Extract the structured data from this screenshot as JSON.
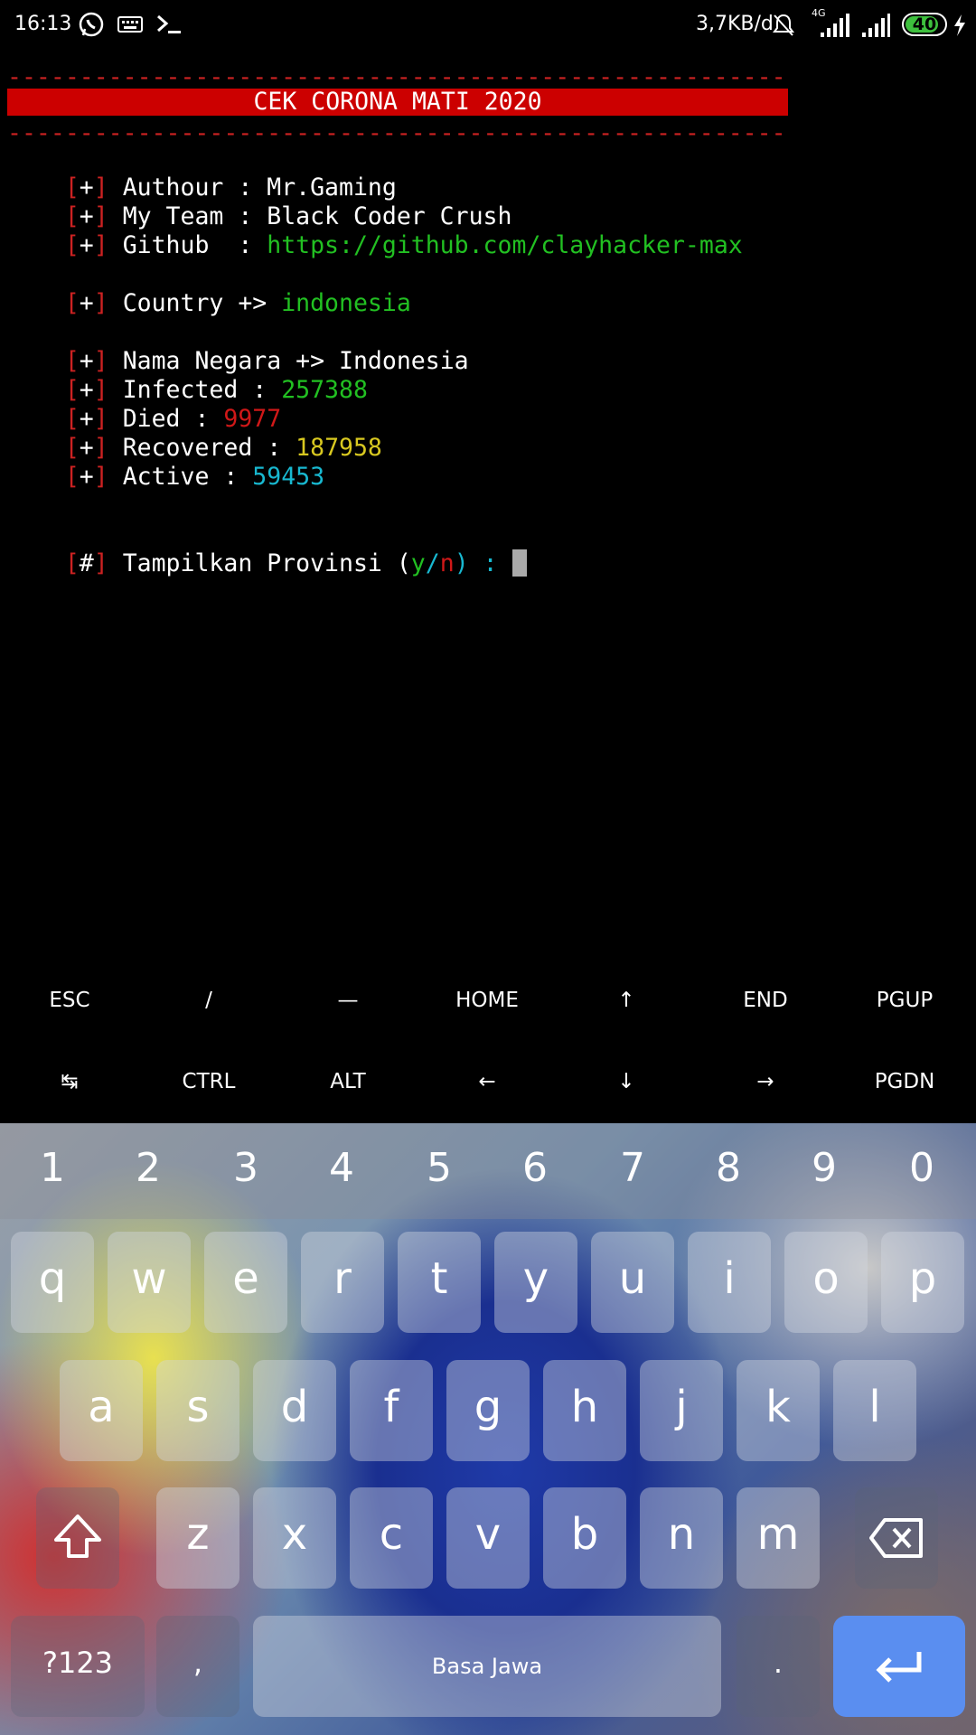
{
  "status_bar": {
    "time": "16:13",
    "left_icons": [
      "whatsapp-icon",
      "keyboard-icon",
      "terminal-icon"
    ],
    "net_speed": "3,7KB/d",
    "network_type": "4G",
    "battery": "40"
  },
  "terminal": {
    "dashes": "------------------------------------------------------",
    "banner": "CEK CORONA MATI 2020",
    "info": [
      {
        "bracket_open": "[",
        "sym": "+",
        "bracket_close": "]",
        "label": " Authour : ",
        "value": "Mr.Gaming"
      },
      {
        "bracket_open": "[",
        "sym": "+",
        "bracket_close": "]",
        "label": " My Team : ",
        "value": "Black Coder Crush"
      },
      {
        "bracket_open": "[",
        "sym": "+",
        "bracket_close": "]",
        "label": " Github  : ",
        "value": "https://github.com/clayhacker-max"
      }
    ],
    "country": {
      "label": " Country +> ",
      "value": "indonesia"
    },
    "results": [
      {
        "label": " Nama Negara +> ",
        "value": "Indonesia"
      },
      {
        "label": " Infected : ",
        "value": "257388"
      },
      {
        "label": " Died : ",
        "value": "9977"
      },
      {
        "label": " Recovered : ",
        "value": "187958"
      },
      {
        "label": " Active : ",
        "value": "59453"
      }
    ],
    "prompt": {
      "sym": "#",
      "label": " Tampilkan Provinsi (",
      "y": "y",
      "slash": "/",
      "n": "n",
      "close": ")",
      "colon": " : "
    }
  },
  "extra_keys": {
    "row1": [
      "ESC",
      "/",
      "—",
      "HOME",
      "↑",
      "END",
      "PGUP"
    ],
    "row2": [
      "↹",
      "CTRL",
      "ALT",
      "←",
      "↓",
      "→",
      "PGDN"
    ]
  },
  "keyboard": {
    "numbers": [
      "1",
      "2",
      "3",
      "4",
      "5",
      "6",
      "7",
      "8",
      "9",
      "0"
    ],
    "row1": [
      "q",
      "w",
      "e",
      "r",
      "t",
      "y",
      "u",
      "i",
      "o",
      "p"
    ],
    "row2": [
      "a",
      "s",
      "d",
      "f",
      "g",
      "h",
      "j",
      "k",
      "l"
    ],
    "row3": [
      "z",
      "x",
      "c",
      "v",
      "b",
      "n",
      "m"
    ],
    "symbols_key": "?123",
    "comma_key": ",",
    "space_label": "Basa Jawa",
    "period_key": ".",
    "icons": [
      "shift-icon",
      "backspace-icon",
      "enter-icon"
    ]
  },
  "colors": {
    "banner_bg": "#cc0000",
    "green": "#22c022",
    "red": "#d01818",
    "yellow": "#d8c820",
    "cyan": "#18b8d0",
    "enter_key": "#5a8ef0"
  }
}
